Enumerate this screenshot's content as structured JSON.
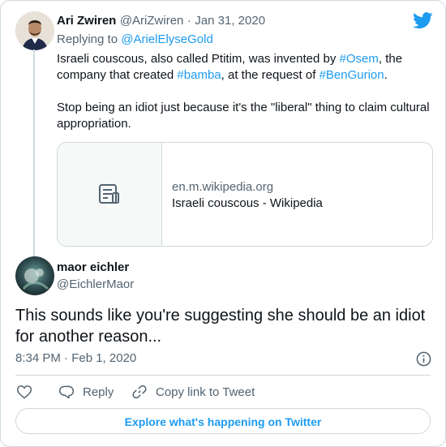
{
  "colors": {
    "accent": "#1d9bf0",
    "text": "#0f1419",
    "muted": "#536471",
    "border": "#cfd9de"
  },
  "parent": {
    "display_name": "Ari Zwiren",
    "handle": "@AriZwiren",
    "separator": "·",
    "date": "Jan 31, 2020",
    "replying_prefix": "Replying to",
    "replying_handle": "@ArielElyseGold",
    "text_parts": {
      "t1": "Israeli couscous, also called Ptitim, was invented by ",
      "h1": "#Osem",
      "t2": ", the company that created ",
      "h2": "#bamba",
      "t3": ", at the request of ",
      "h3": "#BenGurion",
      "t4": "."
    },
    "text_second": "Stop being an idiot just because it's the \"liberal\" thing to claim cultural appropriation.",
    "link_card": {
      "domain": "en.m.wikipedia.org",
      "title": "Israeli couscous - Wikipedia",
      "icon": "article-icon"
    }
  },
  "main": {
    "display_name": "maor eichler",
    "handle": "@EichlerMaor",
    "text": "This sounds like you're suggesting she should be an idiot for another reason...",
    "timestamp": "8:34 PM · Feb 1, 2020"
  },
  "actions": {
    "reply": "Reply",
    "copy_link": "Copy link to Tweet"
  },
  "explore_label": "Explore what's happening on Twitter",
  "icons": [
    "twitter-bird-icon",
    "info-icon",
    "heart-icon",
    "reply-icon",
    "link-icon"
  ]
}
